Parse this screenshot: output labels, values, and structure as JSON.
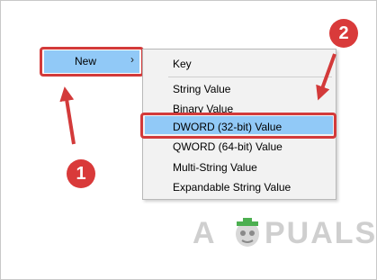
{
  "context_menu": {
    "parent_label": "New",
    "arrow_glyph": "›"
  },
  "submenu": {
    "items": [
      "Key",
      "String Value",
      "Binary Value",
      "DWORD (32-bit) Value",
      "QWORD (64-bit) Value",
      "Multi-String Value",
      "Expandable String Value"
    ],
    "highlighted_index": 3
  },
  "annotations": {
    "step1": "1",
    "step2": "2",
    "color": "#d33a3a"
  },
  "watermark": {
    "logo_text": "APPUALS",
    "left_text": "A",
    "right_text": "PUALS"
  }
}
